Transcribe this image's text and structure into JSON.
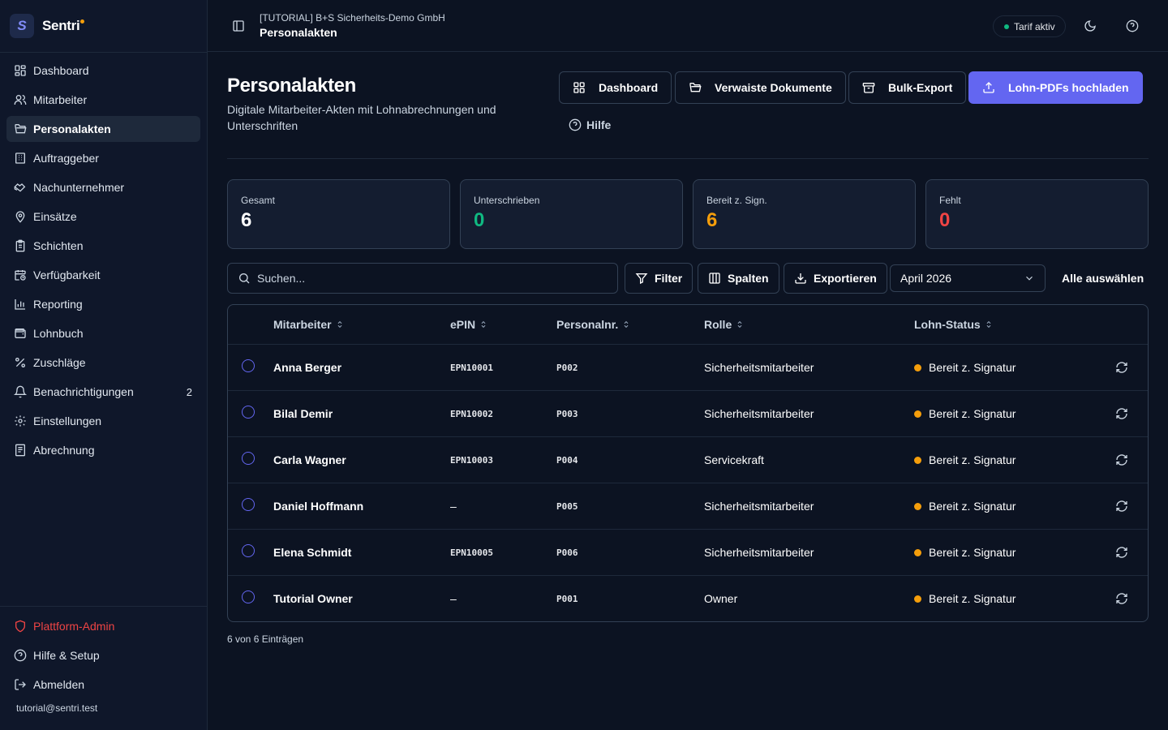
{
  "brand": {
    "name": "Sentri",
    "logo_letter": "S"
  },
  "sidebar": {
    "items": [
      {
        "label": "Dashboard",
        "icon": "dashboard-icon"
      },
      {
        "label": "Mitarbeiter",
        "icon": "users-icon"
      },
      {
        "label": "Personalakten",
        "icon": "folder-open-icon",
        "active": true
      },
      {
        "label": "Auftraggeber",
        "icon": "building-icon"
      },
      {
        "label": "Nachunternehmer",
        "icon": "handshake-icon"
      },
      {
        "label": "Einsätze",
        "icon": "map-pin-icon"
      },
      {
        "label": "Schichten",
        "icon": "clipboard-icon"
      },
      {
        "label": "Verfügbarkeit",
        "icon": "calendar-clock-icon"
      },
      {
        "label": "Reporting",
        "icon": "bar-chart-icon"
      },
      {
        "label": "Lohnbuch",
        "icon": "wallet-icon"
      },
      {
        "label": "Zuschläge",
        "icon": "percent-icon"
      },
      {
        "label": "Benachrichtigungen",
        "icon": "bell-icon",
        "badge": "2"
      },
      {
        "label": "Einstellungen",
        "icon": "gear-icon"
      },
      {
        "label": "Abrechnung",
        "icon": "receipt-icon"
      }
    ],
    "bottom": {
      "admin_label": "Plattform-Admin",
      "help_label": "Hilfe & Setup",
      "logout_label": "Abmelden",
      "user_email": "tutorial@sentri.test"
    }
  },
  "topbar": {
    "tenant": "[TUTORIAL] B+S Sicherheits-Demo GmbH",
    "page": "Personalakten",
    "tarif_label": "Tarif aktiv",
    "tarif_color": "#10b981"
  },
  "header": {
    "title": "Personalakten",
    "subtitle": "Digitale Mitarbeiter-Akten mit Lohnabrechnungen und Unterschriften",
    "buttons": {
      "dashboard": "Dashboard",
      "orphaned": "Verwaiste Dokumente",
      "bulk_export": "Bulk-Export",
      "upload": "Lohn-PDFs hochladen"
    },
    "help_label": "Hilfe",
    "accent_color": "#6366f1"
  },
  "stats": [
    {
      "label": "Gesamt",
      "value": "6",
      "color": "#ffffff"
    },
    {
      "label": "Unterschrieben",
      "value": "0",
      "color": "#10b981"
    },
    {
      "label": "Bereit z. Sign.",
      "value": "6",
      "color": "#f59e0b"
    },
    {
      "label": "Fehlt",
      "value": "0",
      "color": "#ef4444"
    }
  ],
  "toolbar": {
    "search_placeholder": "Suchen...",
    "filter_label": "Filter",
    "columns_label": "Spalten",
    "export_label": "Exportieren",
    "month_value": "April 2026",
    "select_all_label": "Alle auswählen"
  },
  "table": {
    "columns": [
      "Mitarbeiter",
      "ePIN",
      "Personalnr.",
      "Rolle",
      "Lohn-Status"
    ],
    "rows": [
      {
        "name": "Anna Berger",
        "epin": "EPN10001",
        "personalnr": "P002",
        "rolle": "Sicherheitsmitarbeiter",
        "status": "Bereit z. Signatur"
      },
      {
        "name": "Bilal Demir",
        "epin": "EPN10002",
        "personalnr": "P003",
        "rolle": "Sicherheitsmitarbeiter",
        "status": "Bereit z. Signatur"
      },
      {
        "name": "Carla Wagner",
        "epin": "EPN10003",
        "personalnr": "P004",
        "rolle": "Servicekraft",
        "status": "Bereit z. Signatur"
      },
      {
        "name": "Daniel Hoffmann",
        "epin": "–",
        "personalnr": "P005",
        "rolle": "Sicherheitsmitarbeiter",
        "status": "Bereit z. Signatur"
      },
      {
        "name": "Elena Schmidt",
        "epin": "EPN10005",
        "personalnr": "P006",
        "rolle": "Sicherheitsmitarbeiter",
        "status": "Bereit z. Signatur"
      },
      {
        "name": "Tutorial Owner",
        "epin": "–",
        "personalnr": "P001",
        "rolle": "Owner",
        "status": "Bereit z. Signatur"
      }
    ],
    "status_color": "#f59e0b"
  },
  "footer": {
    "count_text": "6 von 6 Einträgen"
  }
}
